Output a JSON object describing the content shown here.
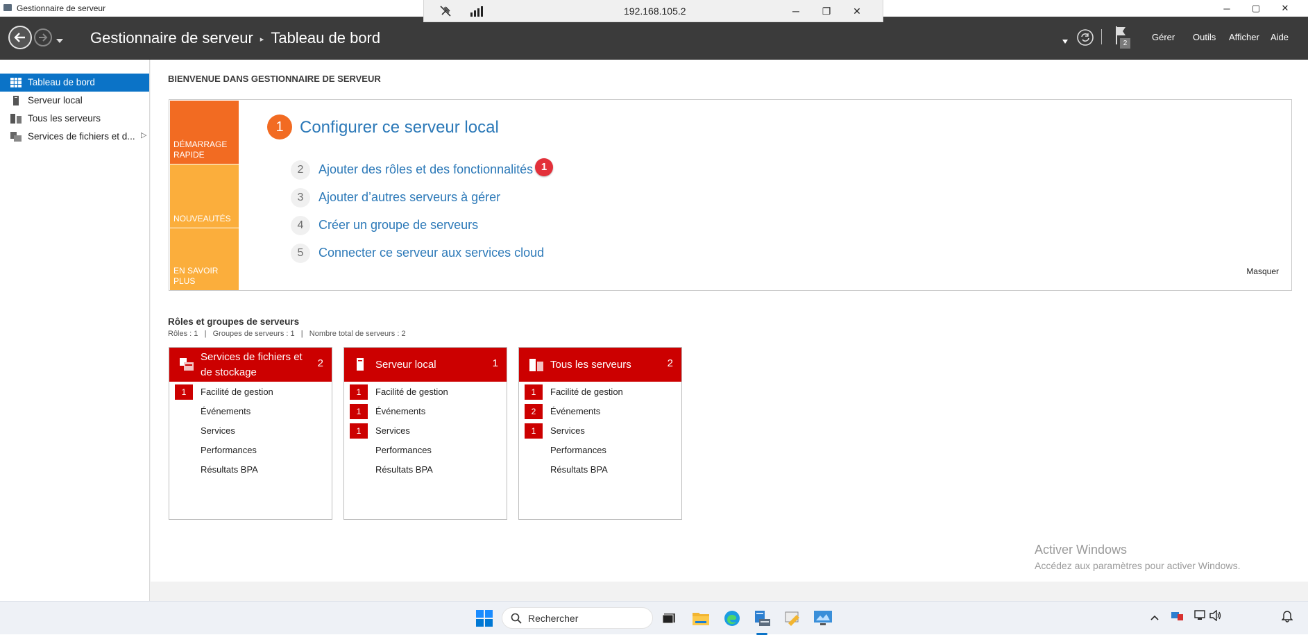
{
  "window": {
    "title": "Gestionnaire de serveur",
    "minimize": "─",
    "maximize": "▢",
    "close": "✕"
  },
  "rdp": {
    "host": "192.168.105.2",
    "minimize": "─",
    "restore": "❐",
    "close": "✕"
  },
  "header": {
    "breadcrumb_root": "Gestionnaire de serveur",
    "breadcrumb_sep": "▸",
    "breadcrumb_page": "Tableau de bord",
    "notification_count": "2",
    "menu": [
      "Gérer",
      "Outils",
      "Afficher",
      "Aide"
    ]
  },
  "sidebar": {
    "items": [
      {
        "label": "Tableau de bord",
        "icon": "dashboard-icon",
        "active": true
      },
      {
        "label": "Serveur local",
        "icon": "server-icon"
      },
      {
        "label": "Tous les serveurs",
        "icon": "servers-icon"
      },
      {
        "label": "Services de fichiers et d...",
        "icon": "file-services-icon"
      }
    ],
    "expand_arrow": "▷"
  },
  "welcome": {
    "title": "BIENVENUE DANS GESTIONNAIRE DE SERVEUR",
    "tiles": [
      "DÉMARRAGE RAPIDE",
      "NOUVEAUTÉS",
      "EN SAVOIR PLUS"
    ],
    "step1": {
      "number": "1",
      "label": "Configurer ce serveur local"
    },
    "steps": [
      {
        "number": "2",
        "label": "Ajouter des rôles et des fonctionnalités"
      },
      {
        "number": "3",
        "label": "Ajouter d’autres serveurs à gérer"
      },
      {
        "number": "4",
        "label": "Créer un groupe de serveurs"
      },
      {
        "number": "5",
        "label": "Connecter ce serveur aux services cloud"
      }
    ],
    "annotation_badge": "1",
    "hide": "Masquer"
  },
  "roles": {
    "title": "Rôles et groupes de serveurs",
    "summary": "Rôles : 1   |   Groupes de serveurs : 1   |   Nombre total de serveurs : 2",
    "cards": [
      {
        "title": "Services de fichiers et de stockage",
        "count": "2",
        "icon": "file-storage-icon",
        "rows": [
          {
            "label": "Facilité de gestion",
            "badge": "1"
          },
          {
            "label": "Événements",
            "badge": ""
          },
          {
            "label": "Services",
            "badge": ""
          },
          {
            "label": "Performances",
            "badge": ""
          },
          {
            "label": "Résultats BPA",
            "badge": ""
          }
        ]
      },
      {
        "title": "Serveur local",
        "count": "1",
        "icon": "server-icon",
        "rows": [
          {
            "label": "Facilité de gestion",
            "badge": "1"
          },
          {
            "label": "Événements",
            "badge": "1"
          },
          {
            "label": "Services",
            "badge": "1"
          },
          {
            "label": "Performances",
            "badge": ""
          },
          {
            "label": "Résultats BPA",
            "badge": ""
          }
        ]
      },
      {
        "title": "Tous les serveurs",
        "count": "2",
        "icon": "servers-icon",
        "rows": [
          {
            "label": "Facilité de gestion",
            "badge": "1"
          },
          {
            "label": "Événements",
            "badge": "2"
          },
          {
            "label": "Services",
            "badge": "1"
          },
          {
            "label": "Performances",
            "badge": ""
          },
          {
            "label": "Résultats BPA",
            "badge": ""
          }
        ]
      }
    ]
  },
  "watermark": {
    "title": "Activer Windows",
    "subtitle": "Accédez aux paramètres pour activer Windows."
  },
  "taskbar": {
    "search_placeholder": "Rechercher"
  },
  "colors": {
    "header_bg": "#3b3b3b",
    "accent_blue": "#0b73c7",
    "quickstart_orange": "#f26b22",
    "tile_amber": "#fbae3c",
    "alert_red": "#cc0000",
    "link_blue": "#2c79b8"
  }
}
